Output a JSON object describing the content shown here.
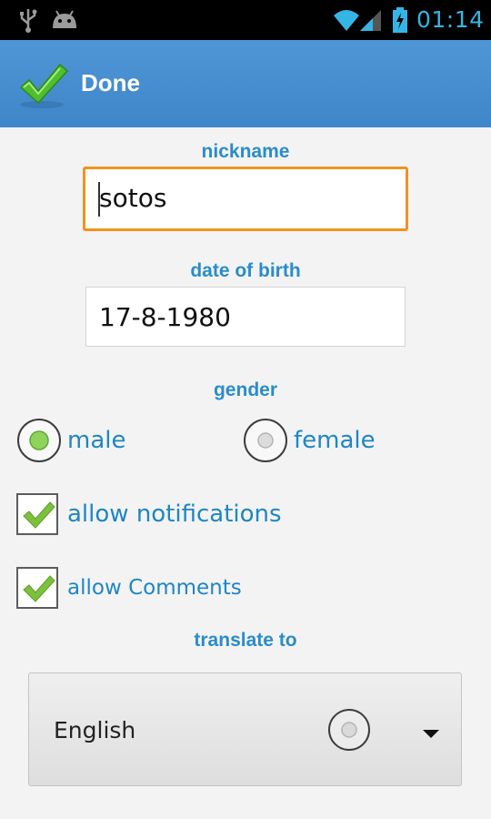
{
  "status_bar": {
    "time": "01:14",
    "icons": [
      "usb-icon",
      "android-icon",
      "wifi-icon",
      "signal-icon",
      "battery-charging-icon"
    ]
  },
  "action_bar": {
    "done_label": "Done",
    "icon": "checkmark-icon"
  },
  "form": {
    "nickname": {
      "label": "nickname",
      "value": "sotos"
    },
    "date_of_birth": {
      "label": "date of birth",
      "value": "17-8-1980"
    },
    "gender": {
      "label": "gender",
      "options": [
        {
          "label": "male",
          "selected": true
        },
        {
          "label": "female",
          "selected": false
        }
      ]
    },
    "allow_notifications": {
      "label": "allow notifications",
      "checked": true
    },
    "allow_comments": {
      "label": "allow Comments",
      "checked": true
    },
    "translate_to": {
      "label": "translate to",
      "value": "English"
    }
  },
  "colors": {
    "accent_blue": "#2a8ccb",
    "action_bar": "#4a90d2",
    "focus_orange": "#f0931f",
    "check_green": "#7cc13c"
  }
}
